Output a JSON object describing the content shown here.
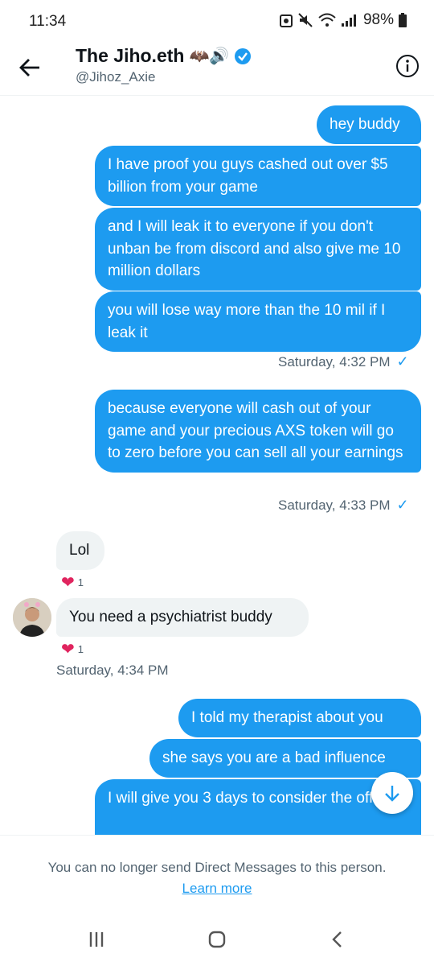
{
  "status_bar": {
    "time": "11:34",
    "battery": "98%"
  },
  "header": {
    "title": "The Jiho.eth",
    "handle": "@Jihoz_Axie",
    "title_emojis": "🦇🔊"
  },
  "messages": [
    {
      "text": "hey buddy",
      "direction": "sent"
    },
    {
      "text": "I have proof you guys cashed out over $5 billion from your game",
      "direction": "sent"
    },
    {
      "text": "and I will leak it to everyone if you don't unban be from discord and also give me 10 million dollars",
      "direction": "sent"
    },
    {
      "text": "you will lose way more than the 10 mil if I leak it",
      "direction": "sent"
    },
    {
      "text": "because everyone will cash out of your game and your precious AXS token will go to zero before you can sell all your earnings",
      "direction": "sent"
    },
    {
      "text": "Lol",
      "direction": "received",
      "reactions": "1"
    },
    {
      "text": "You need a psychiatrist buddy",
      "direction": "received",
      "reactions": "1"
    },
    {
      "text": "I told my therapist about you",
      "direction": "sent"
    },
    {
      "text": "she says you are a bad influence",
      "direction": "sent"
    },
    {
      "text": "I will give you 3 days to consider the offer",
      "direction": "sent"
    }
  ],
  "timestamps": {
    "t1": "Saturday, 4:32 PM",
    "t2": "Saturday, 4:33 PM",
    "t3": "Saturday, 4:34 PM"
  },
  "check_mark": "✓",
  "heart": "❤",
  "footer": {
    "notice": "You can no longer send Direct Messages to this person.",
    "link": "Learn more"
  },
  "colors": {
    "accent": "#1d9bf0",
    "received_bg": "#eff3f4",
    "muted": "#536471"
  }
}
